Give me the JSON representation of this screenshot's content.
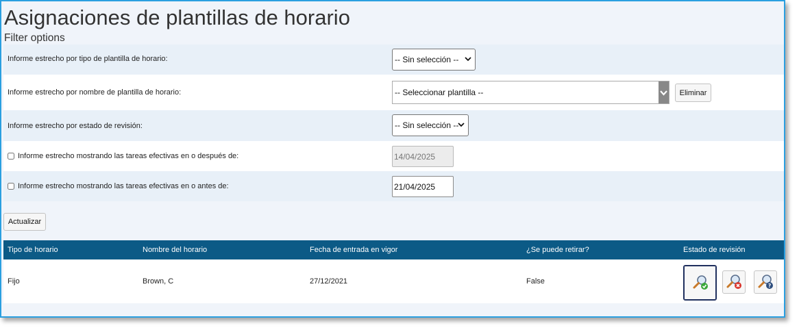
{
  "header": {
    "title": "Asignaciones de plantillas de horario",
    "subtitle": "Filter options"
  },
  "filters": {
    "type": {
      "label": "Informe estrecho por tipo de plantilla de horario:",
      "selected": "-- Sin selección --"
    },
    "name": {
      "label": "Informe estrecho por nombre de plantilla de horario:",
      "selected": "-- Seleccionar plantilla --",
      "remove_label": "Eliminar"
    },
    "review": {
      "label": "Informe estrecho por estado de revisión:",
      "selected": "-- Sin selección --"
    },
    "after": {
      "label": "Informe estrecho mostrando las tareas efectivas en o después de:",
      "checked": false,
      "date": "14/04/2025",
      "disabled": true
    },
    "before": {
      "label": "Informe estrecho mostrando las tareas efectivas en o antes de:",
      "checked": false,
      "date": "21/04/2025",
      "disabled": false
    }
  },
  "actions": {
    "update_label": "Actualizar"
  },
  "table": {
    "columns": [
      "Tipo de horario",
      "Nombre del horario",
      "Fecha de entrada en vigor",
      "¿Se puede retirar?",
      "Estado de revisión"
    ],
    "rows": [
      {
        "type": "Fijo",
        "name": "Brown, C",
        "effective_date": "27/12/2021",
        "can_withdraw": "False"
      }
    ]
  },
  "icons": {
    "approve": "approve-review-icon",
    "reject": "reject-review-icon",
    "pending": "pending-review-icon"
  },
  "colors": {
    "accent": "#2a9fe0",
    "table_header": "#0c5a86",
    "approve": "#3aa83a",
    "reject": "#d9342b",
    "pending": "#2f4f7f"
  }
}
